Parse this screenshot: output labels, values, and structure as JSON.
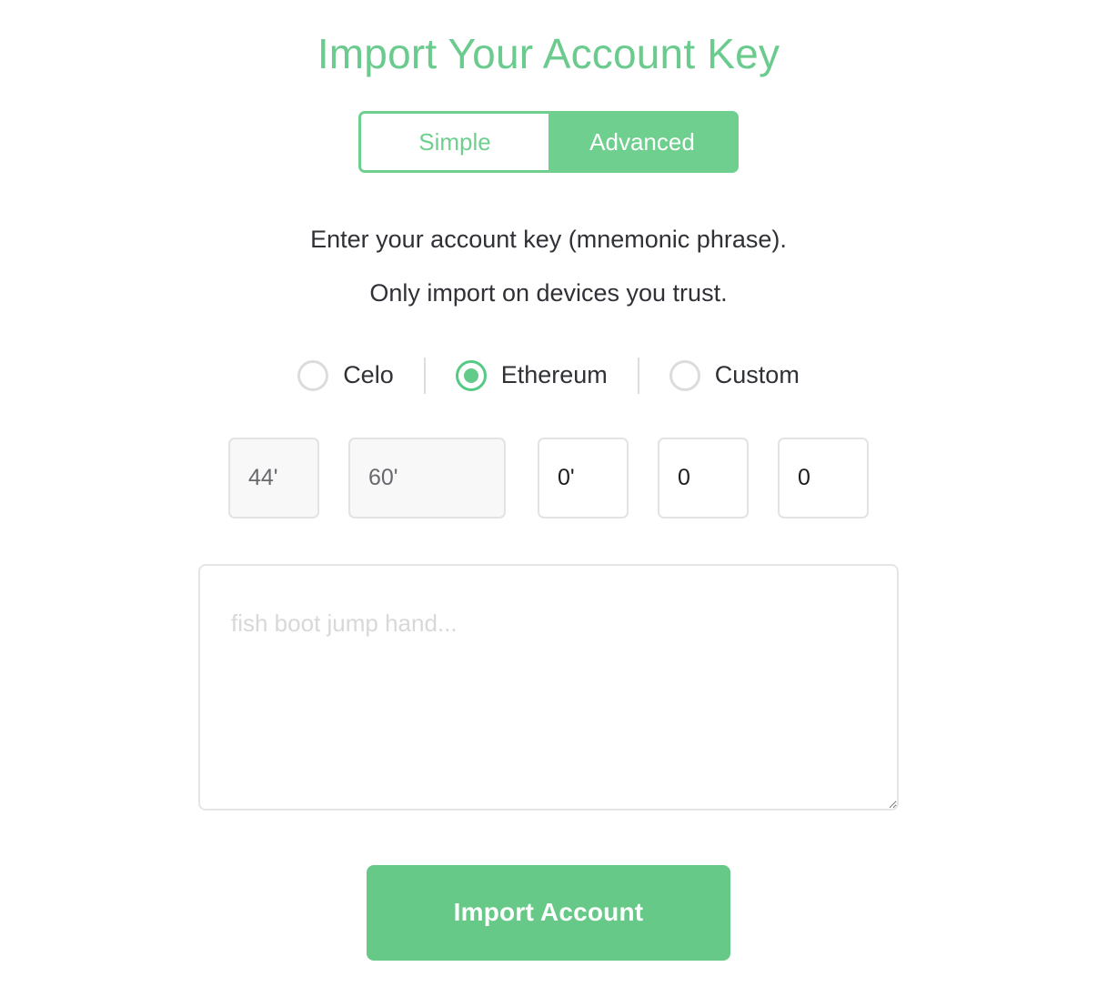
{
  "page": {
    "title": "Import Your Account Key"
  },
  "mode_toggle": {
    "options": [
      {
        "label": "Simple",
        "active": false
      },
      {
        "label": "Advanced",
        "active": true
      }
    ]
  },
  "description": {
    "line1": "Enter your account key (mnemonic phrase).",
    "line2": "Only import on devices you trust."
  },
  "chain_选择": null,
  "chain_radios": {
    "options": [
      {
        "label": "Celo",
        "selected": false
      },
      {
        "label": "Ethereum",
        "selected": true
      },
      {
        "label": "Custom",
        "selected": false
      }
    ]
  },
  "derivation_path": {
    "segments": [
      {
        "value": "44'",
        "disabled": true
      },
      {
        "value": "60'",
        "disabled": true
      },
      {
        "value": "0'",
        "disabled": false
      },
      {
        "value": "0",
        "disabled": false
      },
      {
        "value": "0",
        "disabled": false
      }
    ]
  },
  "mnemonic_input": {
    "placeholder": "fish boot jump hand...",
    "value": ""
  },
  "submit": {
    "label": "Import Account"
  },
  "colors": {
    "accent_green": "#6ecf8e",
    "title_green": "#6bcb8e",
    "button_green": "#67c987",
    "radio_selected": "#54ca85",
    "text_dark": "#2f3136",
    "placeholder_gray": "#d8d8da",
    "border_gray": "#e2e3e5"
  }
}
